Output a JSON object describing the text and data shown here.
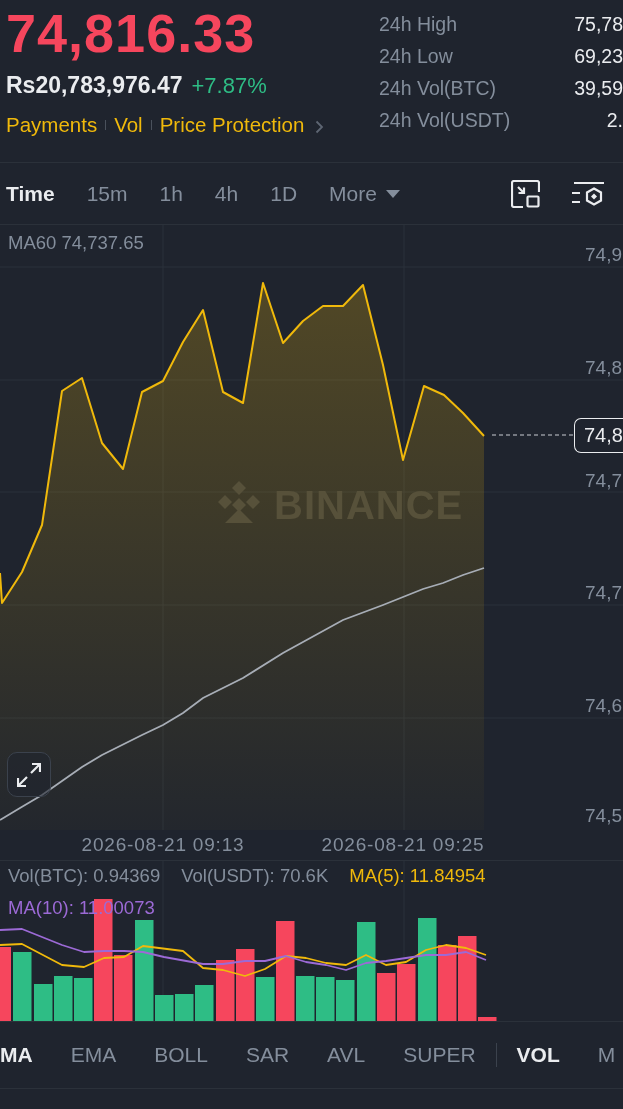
{
  "ticker": {
    "price": "74,816.33",
    "price_up": false,
    "local_price": "Rs20,783,976.47",
    "change": "+7.87%",
    "change_up": true,
    "links": [
      "Payments",
      "Vol",
      "Price Protection"
    ]
  },
  "stats": [
    {
      "label": "24h High",
      "value": "75,78"
    },
    {
      "label": "24h Low",
      "value": "69,23"
    },
    {
      "label": "24h Vol(BTC)",
      "value": "39,59"
    },
    {
      "label": "24h Vol(USDT)",
      "value": "2."
    }
  ],
  "intervals": [
    {
      "label": "Time",
      "selected": true,
      "kind": "interval"
    },
    {
      "label": "15m",
      "selected": false,
      "kind": "interval"
    },
    {
      "label": "1h",
      "selected": false,
      "kind": "interval"
    },
    {
      "label": "4h",
      "selected": false,
      "kind": "interval"
    },
    {
      "label": "1D",
      "selected": false,
      "kind": "interval"
    },
    {
      "label": "More",
      "selected": false,
      "kind": "dropdown"
    }
  ],
  "chart": {
    "legend": "MA60 74,737.65",
    "watermark": "BINANCE",
    "y_labels": [
      "74,9",
      "74,8",
      "74,7",
      "74,7",
      "74,6",
      "74,5"
    ],
    "last_price_tag": "74,8",
    "x_labels": [
      "2026-08-21 09:13",
      "2026-08-21 09:25"
    ]
  },
  "volume": {
    "legends": [
      {
        "text": "Vol(BTC): 0.94369",
        "kind": "value",
        "color": "#848e9c"
      },
      {
        "text": "Vol(USDT): 70.6K",
        "kind": "value",
        "color": "#848e9c"
      },
      {
        "text": "MA(5): 11.84954",
        "kind": "ma",
        "color": "#f0b90b"
      },
      {
        "text": "MA(10): 11.00073",
        "kind": "ma",
        "color": "#9c6ad6"
      }
    ]
  },
  "indicators": {
    "main": [
      {
        "label": "MA",
        "selected": true
      },
      {
        "label": "EMA",
        "selected": false
      },
      {
        "label": "BOLL",
        "selected": false
      },
      {
        "label": "SAR",
        "selected": false
      },
      {
        "label": "AVL",
        "selected": false
      },
      {
        "label": "SUPER",
        "selected": false
      }
    ],
    "sub": [
      {
        "label": "VOL",
        "selected": true
      },
      {
        "label": "M",
        "selected": false
      }
    ]
  }
}
